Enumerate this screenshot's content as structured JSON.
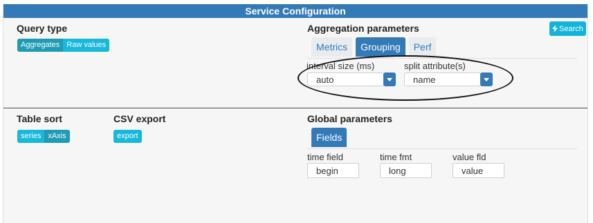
{
  "title": "Service Configuration",
  "search_button": {
    "label": "Search",
    "icon": "bolt-icon"
  },
  "query_type": {
    "title": "Query type",
    "options": [
      "Aggregates",
      "Raw values"
    ]
  },
  "aggregation": {
    "title": "Aggregation parameters",
    "tabs": [
      "Metrics",
      "Grouping",
      "Perf"
    ],
    "active_tab": "Grouping",
    "interval_label": "interval size (ms)",
    "interval_value": "auto",
    "split_label": "split attribute(s)",
    "split_value": "name"
  },
  "table_sort": {
    "title": "Table sort",
    "options": [
      "series",
      "xAxis"
    ]
  },
  "csv_export": {
    "title": "CSV export",
    "button": "export"
  },
  "global": {
    "title": "Global parameters",
    "tab": "Fields",
    "time_field_label": "time field",
    "time_field_value": "begin",
    "time_fmt_label": "time fmt",
    "time_fmt_value": "long",
    "value_fld_label": "value fld",
    "value_fld_value": "value"
  },
  "colors": {
    "header_blue": "#337ab7",
    "button_teal_dark": "#1f9bb5",
    "button_teal_light": "#17b8da",
    "search_button": "#12b4db"
  }
}
